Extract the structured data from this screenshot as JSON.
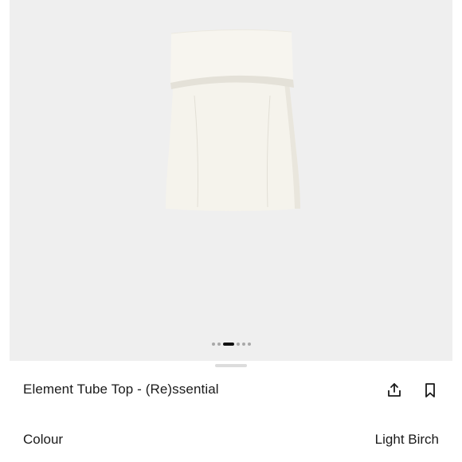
{
  "product": {
    "title": "Element Tube Top - (Re)ssential",
    "image_alt": "Cream strapless tube top"
  },
  "carousel": {
    "total_slides": 6,
    "active_index": 2
  },
  "actions": {
    "share_icon": "share-icon",
    "bookmark_icon": "bookmark-icon"
  },
  "colour": {
    "label": "Colour",
    "value": "Light Birch"
  },
  "colors": {
    "garment": "#f5f3ec",
    "image_background": "#efefef",
    "text": "#1a1a1a"
  }
}
